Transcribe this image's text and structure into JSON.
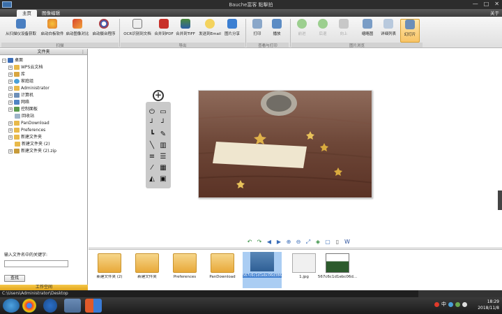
{
  "window": {
    "title": "Bauche富客 點擊拍",
    "controls": [
      "—",
      "□",
      "✕"
    ]
  },
  "tabs": {
    "home": "主页",
    "edit": "图像编辑",
    "about": "关于"
  },
  "ribbon": {
    "scan_group_label": "扫描",
    "export_group_label": "导出",
    "print_group_label": "查看与打印",
    "browse_group_label": "图片浏览",
    "buttons": {
      "from_device": "从扫描仪设备获取",
      "launch_whiteboard": "启动白板软件",
      "launch_compare": "启动图像对比",
      "launch_webcam": "启动摄台程序",
      "ocr": "OCR识别到文档",
      "merge_pdf": "合并到PDF",
      "merge_tiff": "合并到TIFF",
      "send_email": "发送到Email",
      "share": "图片分享",
      "print": "打印",
      "play": "播放",
      "prev": "前进",
      "next": "后退",
      "up": "向上",
      "thumbnails": "缩略图",
      "details": "详细列表",
      "slideshow": "幻灯片"
    }
  },
  "left_panel": {
    "header": "文件夹",
    "tree": [
      {
        "label": "桌面",
        "level": 0
      },
      {
        "label": "WPS云文档",
        "level": 1
      },
      {
        "label": "库",
        "level": 1
      },
      {
        "label": "家庭组",
        "level": 1
      },
      {
        "label": "Administrator",
        "level": 1
      },
      {
        "label": "计算机",
        "level": 1
      },
      {
        "label": "网络",
        "level": 1
      },
      {
        "label": "控制面板",
        "level": 1
      },
      {
        "label": "回收站",
        "level": 1
      },
      {
        "label": "PanDownload",
        "level": 1
      },
      {
        "label": "Preferences",
        "level": 1
      },
      {
        "label": "新建文件夹",
        "level": 1
      },
      {
        "label": "新建文件夹 (2)",
        "level": 1
      },
      {
        "label": "新建文件夹 (2).zip",
        "level": 1
      }
    ],
    "search_label": "输入文件名中的关键字:",
    "search_value": "",
    "search_button": "查找",
    "workspace": "工作空间"
  },
  "thumbnails": [
    {
      "label": "新建文件夹 (2)",
      "kind": "folder"
    },
    {
      "label": "新建文件夹",
      "kind": "folder"
    },
    {
      "label": "Preferences",
      "kind": "folder"
    },
    {
      "label": "PanDownload",
      "kind": "folder"
    },
    {
      "label": "567c6c1d1ebc06d386a2a99de98.8d98.jpg",
      "kind": "image",
      "selected": true
    },
    {
      "label": "1.jpg",
      "kind": "doc"
    },
    {
      "label": "567c6c1d1ebc06d...",
      "kind": "image2"
    }
  ],
  "status": {
    "path": "C:\\Users\\Administrator\\Desktop"
  },
  "taskbar": {
    "time": "18:29",
    "date": "2018/11/8",
    "ime": "中"
  }
}
